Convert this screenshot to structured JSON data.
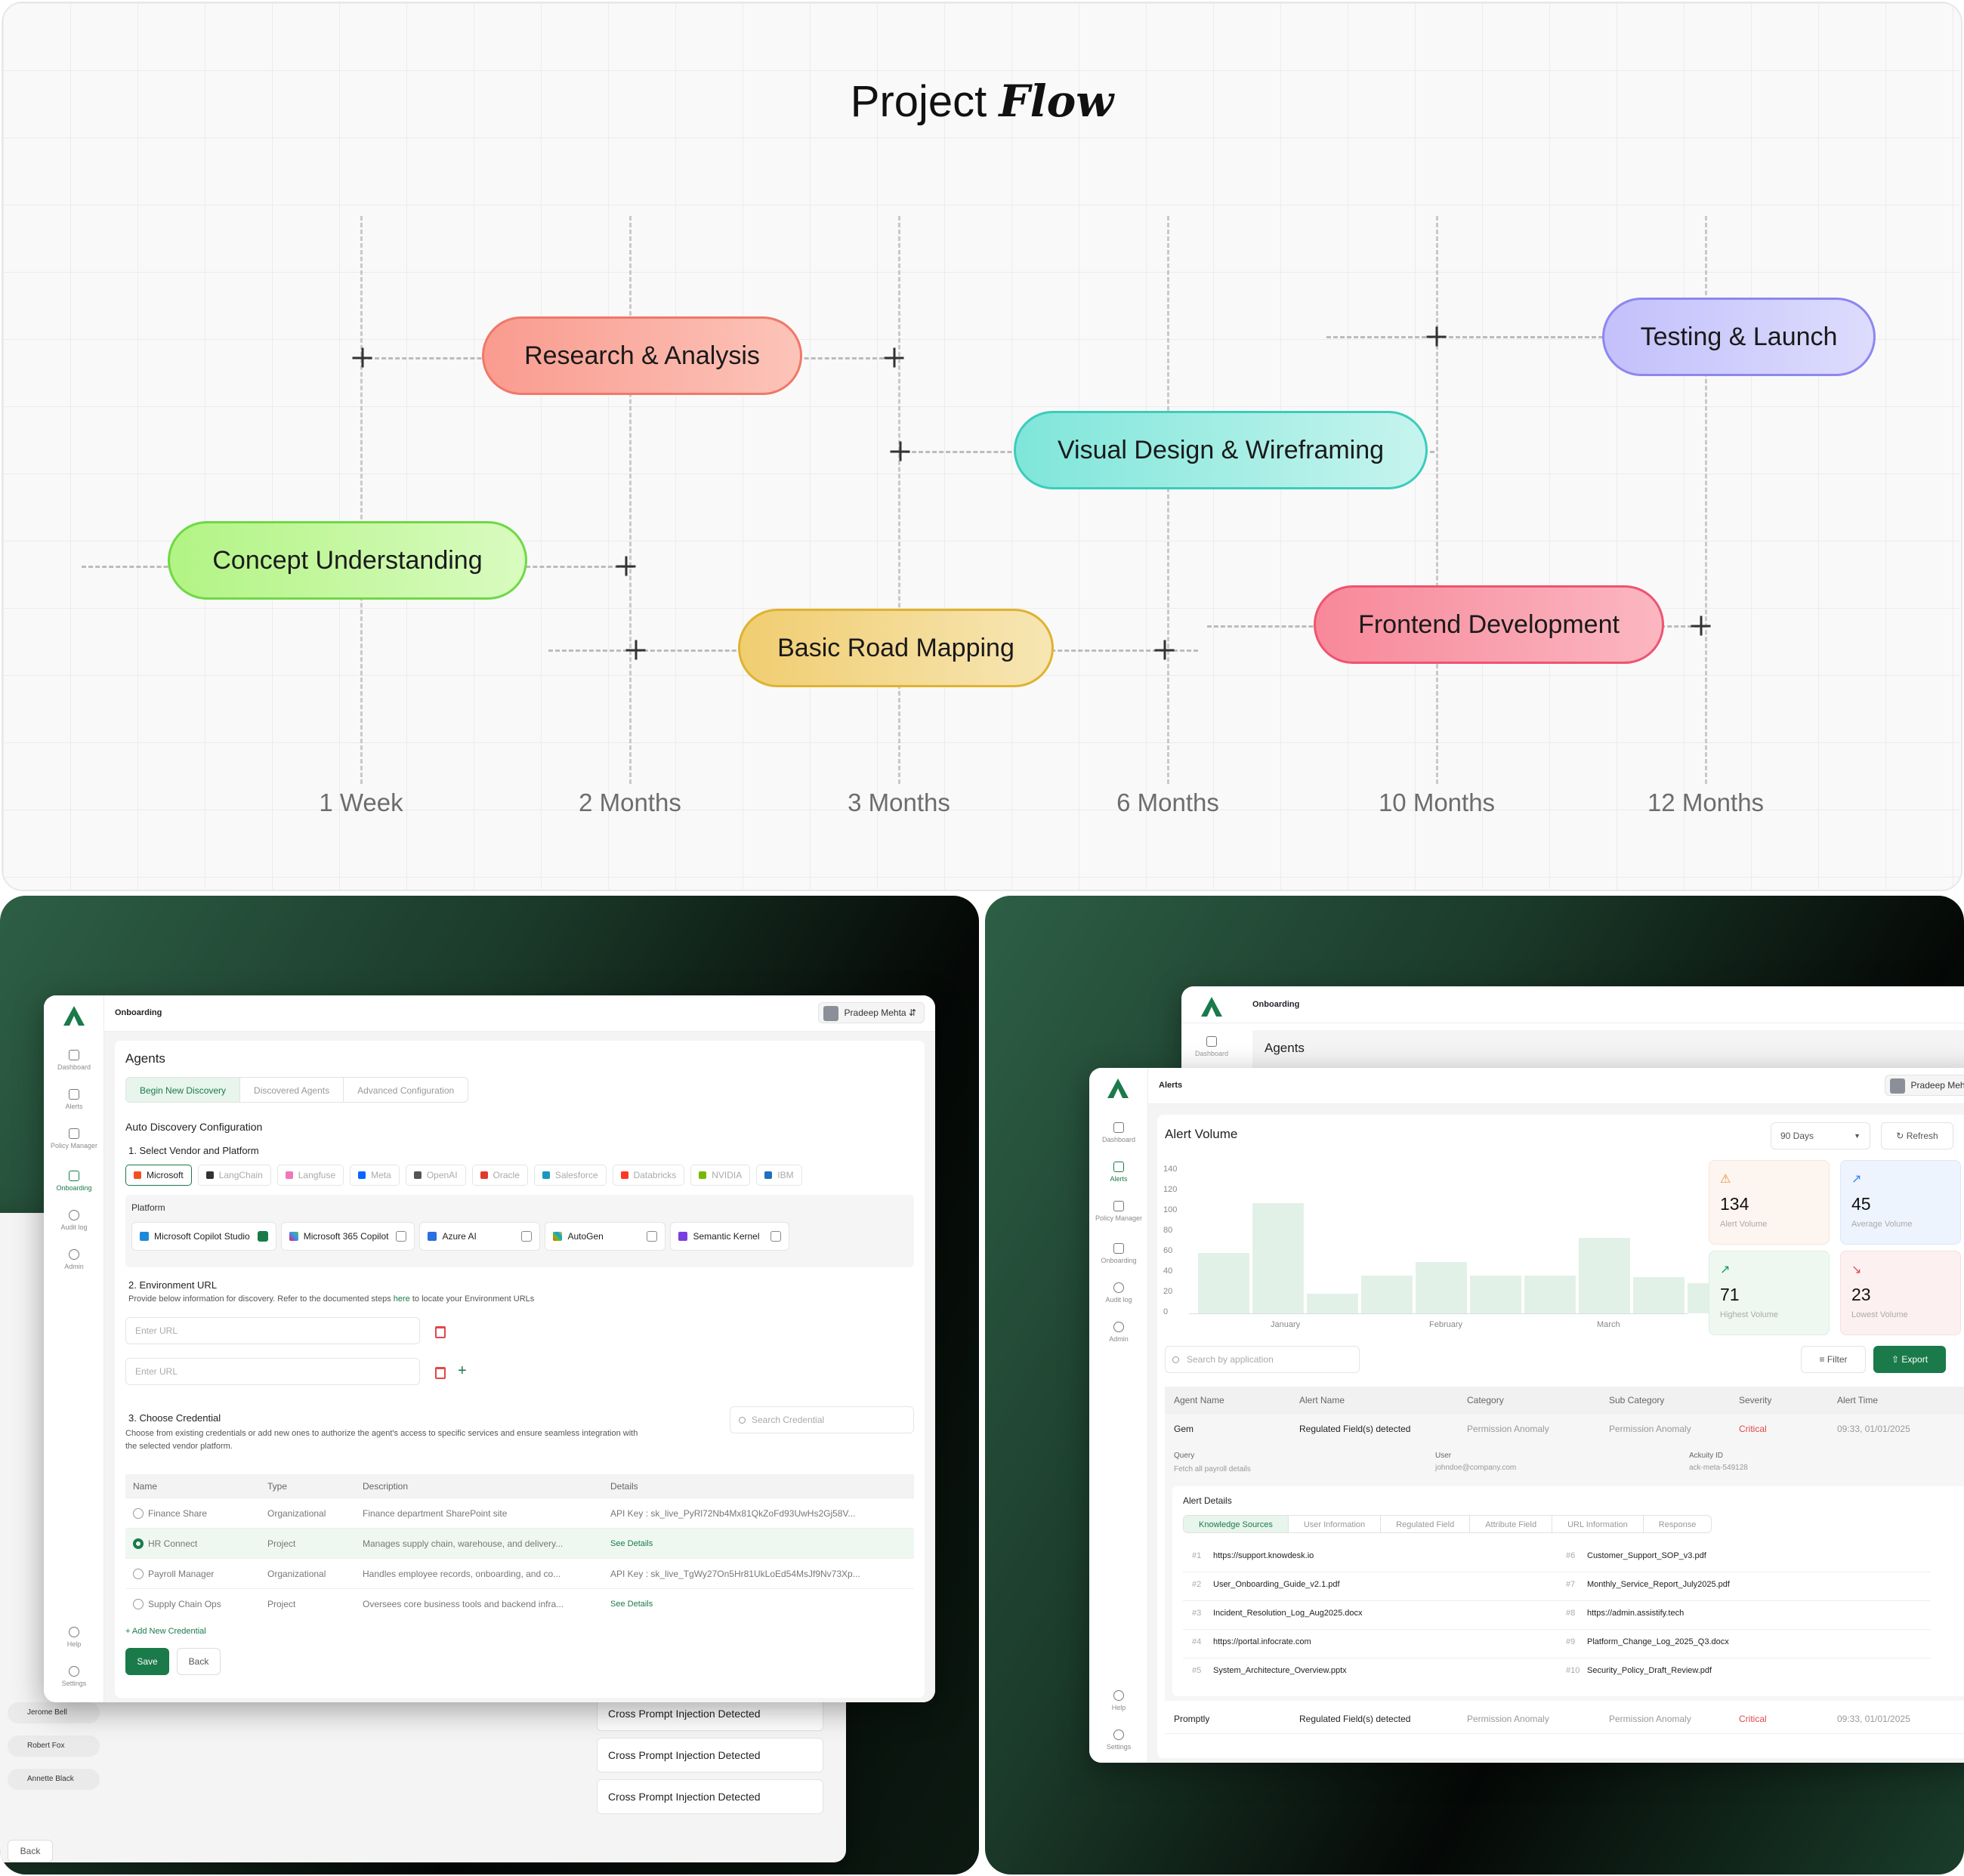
{
  "flow": {
    "title_plain": "Project",
    "title_italic": "Flow",
    "axis": [
      "1 Week",
      "2 Months",
      "3 Months",
      "6 Months",
      "10 Months",
      "12 Months"
    ],
    "tasks": [
      {
        "label": "Research & Analysis",
        "color": "#f9a59a"
      },
      {
        "label": "Testing & Launch",
        "color": "#c9c7fb"
      },
      {
        "label": "Visual Design & Wireframing",
        "color": "#8ee8dc"
      },
      {
        "label": "Concept Understanding",
        "color": "#b9f58e"
      },
      {
        "label": "Frontend Development",
        "color": "#f8929f"
      },
      {
        "label": "Basic Road Mapping",
        "color": "#f1d27c"
      }
    ]
  },
  "onboarding": {
    "breadcrumb": "Onboarding",
    "user": "Pradeep Mehta",
    "sidebar": [
      "Dashboard",
      "Alerts",
      "Policy Manager",
      "Onboarding",
      "Audit log",
      "Admin"
    ],
    "sidebar_bottom": [
      "Help",
      "Settings"
    ],
    "title": "Agents",
    "tabs": [
      "Begin New Discovery",
      "Discovered Agents",
      "Advanced Configuration"
    ],
    "section_title": "Auto Discovery Configuration",
    "step1": "1. Select Vendor and Platform",
    "vendors": [
      "Microsoft",
      "LangChain",
      "Langfuse",
      "Meta",
      "OpenAI",
      "Oracle",
      "Salesforce",
      "Databricks",
      "NVIDIA",
      "IBM"
    ],
    "platform_label": "Platform",
    "platforms": [
      "Microsoft Copilot Studio",
      "Microsoft 365 Copilot",
      "Azure AI",
      "AutoGen",
      "Semantic Kernel"
    ],
    "step2": "2. Environment URL",
    "step2_desc_a": "Provide below information for discovery. Refer to the documented steps",
    "step2_link": "here",
    "step2_desc_b": "to locate your Environment URLs",
    "url_placeholder": "Enter URL",
    "step3": "3. Choose Credential",
    "step3_desc": "Choose from existing credentials or add new ones to authorize the agent's access to specific services and ensure seamless integration with the selected vendor platform.",
    "search_placeholder": "Search Credential",
    "cred_headers": [
      "Name",
      "Type",
      "Description",
      "Details"
    ],
    "credentials": [
      {
        "name": "Finance Share",
        "type": "Organizational",
        "desc": "Finance department SharePoint site",
        "details": "API Key : sk_live_PyRl72Nb4Mx81QkZoFd93UwHs2Gj58V..."
      },
      {
        "name": "HR Connect",
        "type": "Project",
        "desc": "Manages supply chain, warehouse, and delivery...",
        "details": "See Details"
      },
      {
        "name": "Payroll Manager",
        "type": "Organizational",
        "desc": "Handles employee records, onboarding, and co...",
        "details": "API Key : sk_live_TgWy27On5Hr81UkLoEd54MsJf9Nv73Xp..."
      },
      {
        "name": "Supply Chain Ops",
        "type": "Project",
        "desc": "Oversees core business tools and backend infra...",
        "details": "See Details"
      }
    ],
    "add_credential": "+ Add New Credential",
    "save": "Save",
    "back": "Back",
    "behind": {
      "people": [
        "Jerome Bell",
        "Robert Fox",
        "Annette Black"
      ],
      "alerts": [
        "Cross Prompt Injection Detected",
        "Cross Prompt Injection Detected",
        "Cross Prompt Injection Detected"
      ],
      "back": "Back"
    }
  },
  "alerts": {
    "back_crumb": "Onboarding",
    "back_title": "Agents",
    "back_sidebar": "Dashboard",
    "breadcrumb": "Alerts",
    "user": "Pradeep Mehta",
    "sidebar": [
      "Dashboard",
      "Alerts",
      "Policy Manager",
      "Onboarding",
      "Audit log",
      "Admin"
    ],
    "sidebar_bottom": [
      "Help",
      "Settings"
    ],
    "title": "Alert Volume",
    "range": "90 Days",
    "refresh": "Refresh",
    "y_ticks": [
      "140",
      "120",
      "100",
      "80",
      "60",
      "40",
      "20",
      "0"
    ],
    "months": [
      "January",
      "February",
      "March"
    ],
    "stats": [
      {
        "value": "134",
        "label": "Alert Volume",
        "color": "#fdf5ef",
        "icon": "alarm-icon"
      },
      {
        "value": "45",
        "label": "Average Volume",
        "color": "#eef4fd",
        "icon": "trend-icon"
      },
      {
        "value": "71",
        "label": "Highest Volume",
        "color": "#eef8f1",
        "icon": "trend-up-icon"
      },
      {
        "value": "23",
        "label": "Lowest Volume",
        "color": "#fdf0f0",
        "icon": "trend-down-icon"
      }
    ],
    "search_placeholder": "Search by application",
    "filter": "Filter",
    "export": "Export",
    "headers": [
      "Agent Name",
      "Alert Name",
      "Category",
      "Sub Category",
      "Severity",
      "Alert Time"
    ],
    "rows": [
      {
        "agent": "Gem",
        "alert": "Regulated Field(s) detected",
        "category": "Permission Anomaly",
        "sub": "Permission Anomaly",
        "severity": "Critical",
        "time": "09:33, 01/01/2025"
      },
      {
        "agent": "Promptly",
        "alert": "Regulated Field(s) detected",
        "category": "Permission Anomaly",
        "sub": "Permission Anomaly",
        "severity": "Critical",
        "time": "09:33, 01/01/2025"
      }
    ],
    "expanded": {
      "query_label": "Query",
      "query": "Fetch all payroll details",
      "user_label": "User",
      "user": "johndoe@company.com",
      "id_label": "Ackuity ID",
      "id": "ack-meta-549128",
      "details_title": "Alert Details",
      "tabs": [
        "Knowledge Sources",
        "User Information",
        "Regulated Field",
        "Attribute Field",
        "URL Information",
        "Response"
      ],
      "sources": [
        {
          "n": "#1",
          "v": "https://support.knowdesk.io"
        },
        {
          "n": "#2",
          "v": "User_Onboarding_Guide_v2.1.pdf"
        },
        {
          "n": "#3",
          "v": "Incident_Resolution_Log_Aug2025.docx"
        },
        {
          "n": "#4",
          "v": "https://portal.infocrate.com"
        },
        {
          "n": "#5",
          "v": "System_Architecture_Overview.pptx"
        },
        {
          "n": "#6",
          "v": "Customer_Support_SOP_v3.pdf"
        },
        {
          "n": "#7",
          "v": "Monthly_Service_Report_July2025.pdf"
        },
        {
          "n": "#8",
          "v": "https://admin.assistify.tech"
        },
        {
          "n": "#9",
          "v": "Platform_Change_Log_2025_Q3.docx"
        },
        {
          "n": "#10",
          "v": "Security_Policy_Draft_Review.pdf"
        }
      ]
    }
  }
}
